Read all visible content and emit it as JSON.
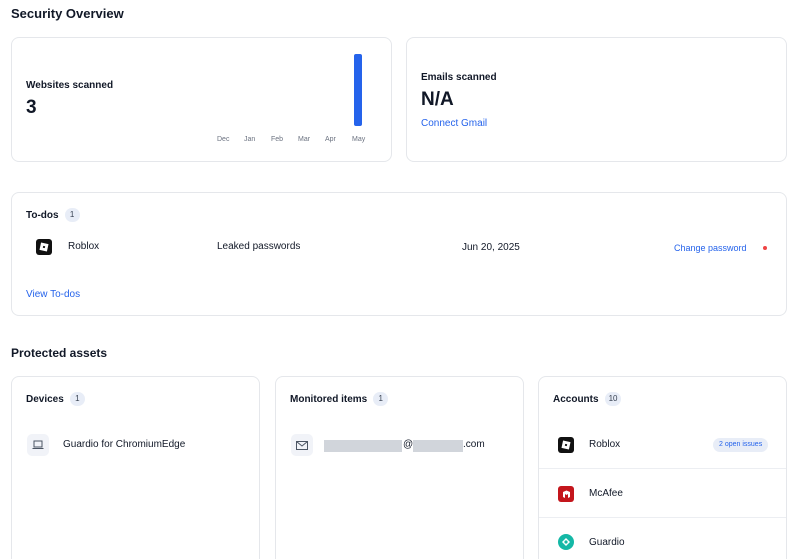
{
  "page": {
    "title": "Security Overview",
    "protected_title": "Protected assets"
  },
  "websites": {
    "label": "Websites scanned",
    "value": "3",
    "months": [
      "Dec",
      "Jan",
      "Feb",
      "Mar",
      "Apr",
      "May"
    ],
    "bar_values": [
      0,
      0,
      0,
      0,
      0,
      3
    ],
    "bar_color": "#2563eb"
  },
  "emails": {
    "label": "Emails scanned",
    "value": "N/A",
    "link": "Connect Gmail"
  },
  "todos": {
    "title": "To-dos",
    "count": "1",
    "items": [
      {
        "app": "Roblox",
        "issue": "Leaked passwords",
        "date": "Jun 20, 2025",
        "action": "Change password"
      }
    ],
    "view_link": "View To-dos"
  },
  "devices": {
    "title": "Devices",
    "count": "1",
    "items": [
      {
        "name": "Guardio for ChromiumEdge",
        "icon": "laptop-icon"
      }
    ]
  },
  "monitored": {
    "title": "Monitored items",
    "count": "1",
    "items": [
      {
        "email_at": "@",
        "email_tld": ".com",
        "icon": "mail-icon"
      }
    ]
  },
  "accounts": {
    "title": "Accounts",
    "count": "10",
    "items": [
      {
        "name": "Roblox",
        "badge": "2 open issues",
        "icon": "roblox-icon"
      },
      {
        "name": "McAfee",
        "icon": "mcafee-icon"
      },
      {
        "name": "Guardio",
        "icon": "guardio-icon"
      }
    ]
  },
  "colors": {
    "accent": "#2563eb",
    "alert": "#ef4444",
    "border": "#e5e7eb"
  }
}
